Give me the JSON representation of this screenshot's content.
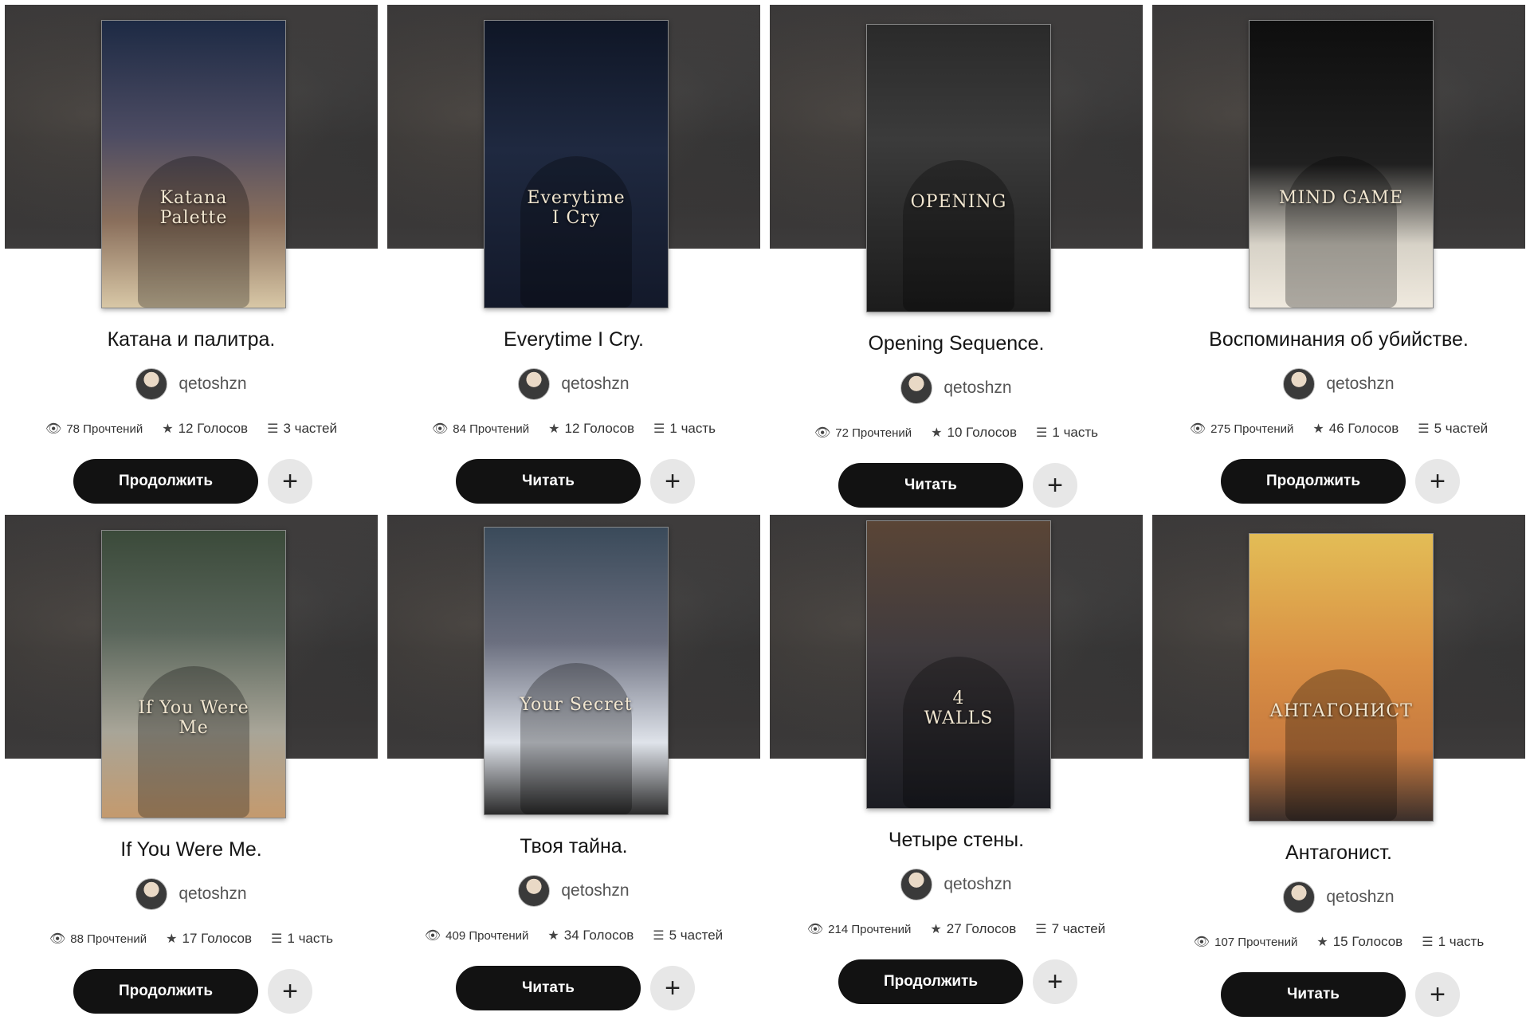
{
  "books": [
    {
      "title": "Катана и палитра.",
      "cover_title": "Katana\nPalette",
      "author": "qetoshzn",
      "reads": "78 Прочтений",
      "votes": "12 Голосов",
      "parts": "3 частей",
      "action": "Продолжить",
      "add": "+"
    },
    {
      "title": "Everytime I Cry.",
      "cover_title": "Everytime\nI Cry",
      "author": "qetoshzn",
      "reads": "84 Прочтений",
      "votes": "12 Голосов",
      "parts": "1 часть",
      "action": "Читать",
      "add": "+"
    },
    {
      "title": "Opening Sequence.",
      "cover_title": "OPENING",
      "author": "qetoshzn",
      "reads": "72 Прочтений",
      "votes": "10 Голосов",
      "parts": "1 часть",
      "action": "Читать",
      "add": "+"
    },
    {
      "title": "Воспоминания об убийстве.",
      "cover_title": "MIND GAME",
      "author": "qetoshzn",
      "reads": "275 Прочтений",
      "votes": "46 Голосов",
      "parts": "5 частей",
      "action": "Продолжить",
      "add": "+"
    },
    {
      "title": "If You Were Me.",
      "cover_title": "If You Were\nMe",
      "author": "qetoshzn",
      "reads": "88 Прочтений",
      "votes": "17 Голосов",
      "parts": "1 часть",
      "action": "Продолжить",
      "add": "+"
    },
    {
      "title": "Твоя тайна.",
      "cover_title": "Your Secret",
      "author": "qetoshzn",
      "reads": "409 Прочтений",
      "votes": "34 Голосов",
      "parts": "5 частей",
      "action": "Читать",
      "add": "+"
    },
    {
      "title": "Четыре стены.",
      "cover_title": "4\nWALLS",
      "author": "qetoshzn",
      "reads": "214 Прочтений",
      "votes": "27 Голосов",
      "parts": "7 частей",
      "action": "Продолжить",
      "add": "+"
    },
    {
      "title": "Антагонист.",
      "cover_title": "АНТАГОНИСТ",
      "author": "qetoshzn",
      "reads": "107 Прочтений",
      "votes": "15 Голосов",
      "parts": "1 часть",
      "action": "Читать",
      "add": "+"
    }
  ],
  "icons": {
    "reads": "eye-icon",
    "votes": "star-icon",
    "parts": "list-icon",
    "add": "plus-icon"
  }
}
